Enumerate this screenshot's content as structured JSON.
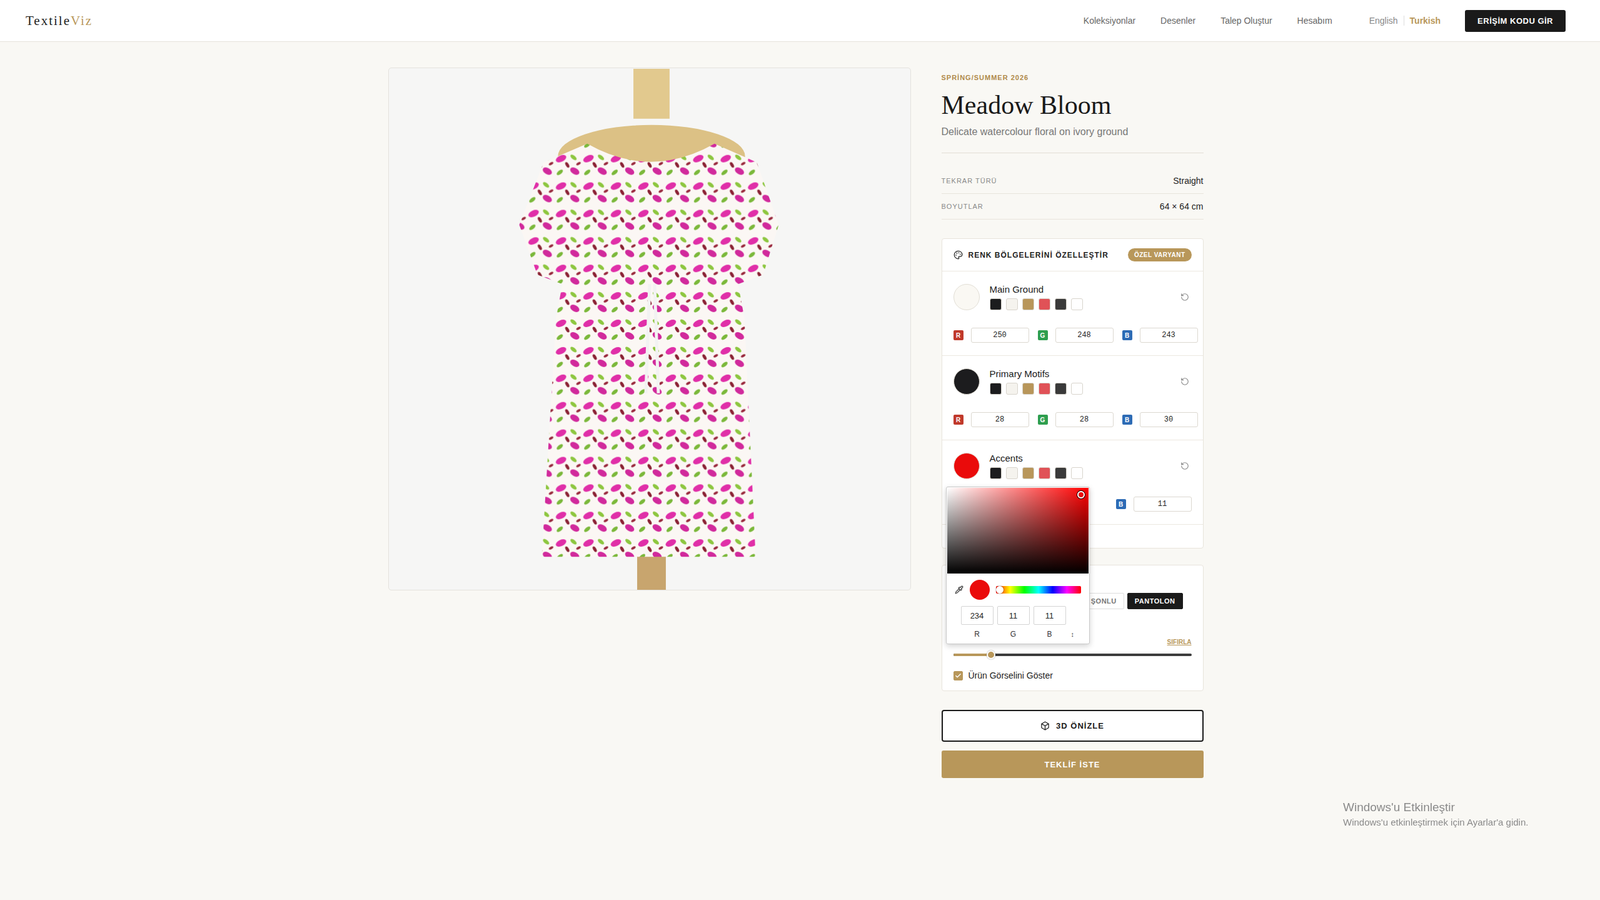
{
  "header": {
    "logo": {
      "main": "Textile",
      "accent": "Viz"
    },
    "nav": [
      "Koleksiyonlar",
      "Desenler",
      "Talep Oluştur",
      "Hesabım"
    ],
    "languages": [
      {
        "label": "English",
        "selected": false
      },
      {
        "label": "Turkish",
        "selected": true
      }
    ],
    "access_button": "ERİŞİM KODU GİR"
  },
  "product": {
    "collection": "SPRİNG/SUMMER 2026",
    "title": "Meadow Bloom",
    "subtitle": "Delicate watercolour floral on ivory ground",
    "specs": [
      {
        "label": "TEKRAR TÜRÜ",
        "value": "Straight"
      },
      {
        "label": "BOYUTLAR",
        "value": "64 × 64 cm"
      }
    ]
  },
  "customizer": {
    "title": "RENK BÖLGELERİNİ ÖZELLEŞTİR",
    "badge": "ÖZEL VARYANT",
    "regions": [
      {
        "name": "Main Ground",
        "color": "#faf8f3",
        "presets": [
          "#1c1c1e",
          "#f5f3ee",
          "#b8965a",
          "#e05257",
          "#3a3a3a",
          "#ffffff"
        ],
        "rgb": [
          {
            "label": "R",
            "value": "250",
            "color": "#c0392b"
          },
          {
            "label": "G",
            "value": "248",
            "color": "#2e9e4f"
          },
          {
            "label": "B",
            "value": "243",
            "color": "#2d6bb5"
          }
        ]
      },
      {
        "name": "Primary Motifs",
        "color": "#1c1c1e",
        "presets": [
          "#1c1c1e",
          "#f5f3ee",
          "#b8965a",
          "#e05257",
          "#3a3a3a",
          "#ffffff"
        ],
        "rgb": [
          {
            "label": "R",
            "value": "28",
            "color": "#c0392b"
          },
          {
            "label": "G",
            "value": "28",
            "color": "#2e9e4f"
          },
          {
            "label": "B",
            "value": "30",
            "color": "#2d6bb5"
          }
        ]
      },
      {
        "name": "Accents",
        "color": "#ea0b0b",
        "presets": [
          "#1c1c1e",
          "#f5f3ee",
          "#b8965a",
          "#e05257",
          "#3a3a3a",
          "#ffffff"
        ],
        "rgb": [
          {
            "label": "B",
            "value": "11",
            "color": "#2d6bb5"
          }
        ],
        "picker": {
          "color": "#ea0b0b",
          "hue": 0,
          "saturation": 0.95,
          "brightness": 0.92,
          "fields": [
            {
              "label": "R",
              "value": "234"
            },
            {
              "label": "G",
              "value": "11"
            },
            {
              "label": "B",
              "value": "11"
            }
          ],
          "toggle": "↕"
        }
      }
    ]
  },
  "garment": {
    "tabs": [
      {
        "label": "ŞONLU",
        "selected": false
      },
      {
        "label": "PANTOLON",
        "selected": true
      }
    ],
    "reset": "SIFIRLA",
    "scale": {
      "level": 0.16
    },
    "checkbox": {
      "label": "Ürün Görselini Göster",
      "checked": true
    }
  },
  "actions": {
    "preview": "3D ÖNİZLE",
    "quote": "TEKLİF İSTE"
  },
  "watermark": {
    "title": "Windows'u Etkinleştir",
    "subtitle": "Windows'u etkinleştirmek için Ayarlar'a gidin."
  }
}
